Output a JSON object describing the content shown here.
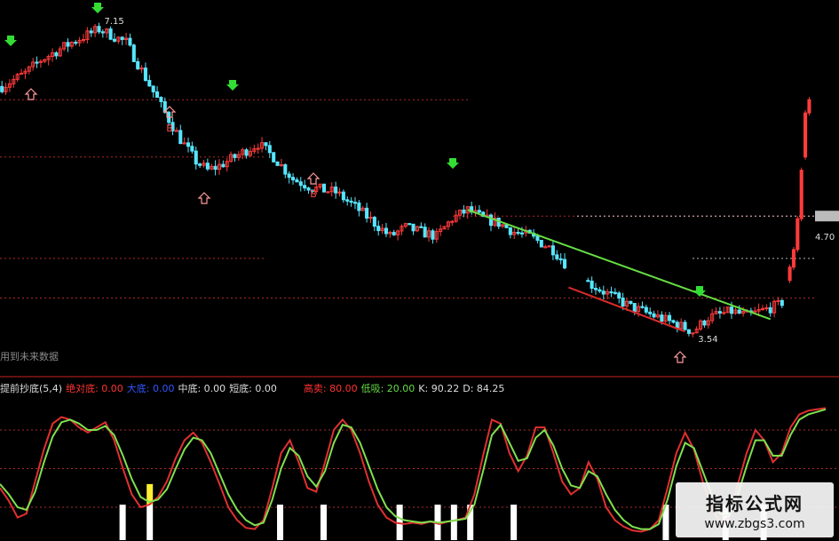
{
  "colors": {
    "background": "#000000",
    "up": "#ff3b3b",
    "down": "#56e6ff",
    "trend_green": "#66dd44",
    "trend_red": "#d92b2b",
    "dotted_level": "#cc3333",
    "arrow_green": "#33dd33",
    "fast_line": "#e03030",
    "slow_line": "#7fe04f",
    "bottom_bar": "#ffffff",
    "signal_bar": "#ffee33"
  },
  "price_labels": {
    "high": "7.15",
    "low": "3.54",
    "right_marker": "4.70"
  },
  "buy_label": "B",
  "hint_text": "用到未来数据",
  "indicator_header": [
    {
      "text": "提前抄底(5,4)",
      "color": "#dddddd"
    },
    {
      "text": "绝对底: 0.00",
      "color": "#ff3333"
    },
    {
      "text": "大底: 0.00",
      "color": "#3355ff"
    },
    {
      "text": "中底: 0.00",
      "color": "#dddddd"
    },
    {
      "text": "短底: 0.00",
      "color": "#dddddd"
    },
    {
      "text": "高卖: 80.00",
      "color": "#ff3333"
    },
    {
      "text": "低吸: 20.00",
      "color": "#66dd44"
    },
    {
      "text": "K: 90.22",
      "color": "#dddddd"
    },
    {
      "text": "D: 84.25",
      "color": "#dddddd"
    }
  ],
  "watermark": {
    "title": "指标公式网",
    "url": "www.zbgs3.com"
  },
  "chart_data": [
    {
      "type": "candlestick",
      "title": "",
      "ylim": [
        3.3,
        7.3
      ],
      "reference_levels": [
        6.25,
        5.6,
        4.93,
        4.45,
        4.0
      ],
      "trendlines": [
        {
          "name": "",
          "color": "green",
          "from": {
            "bar": 120,
            "price": 5.0
          },
          "to": {
            "bar": 198,
            "price": 3.76
          }
        },
        {
          "name": "",
          "color": "red",
          "from": {
            "bar": 146,
            "price": 4.12
          },
          "to": {
            "bar": 176,
            "price": 3.62
          }
        }
      ],
      "extremes": [
        {
          "label": "7.15",
          "bar": 25,
          "price": 7.15
        },
        {
          "label": "3.54",
          "bar": 178,
          "price": 3.54
        }
      ]
    },
    {
      "type": "line",
      "title": "提前抄底(5,4)",
      "ylim": [
        0,
        100
      ],
      "reference_levels": [
        80,
        50,
        20
      ],
      "series": [
        {
          "name": "K",
          "color": "#e03030",
          "values": [
            35,
            25,
            12,
            15,
            40,
            65,
            85,
            90,
            88,
            82,
            78,
            82,
            86,
            72,
            50,
            30,
            20,
            22,
            28,
            40,
            58,
            72,
            78,
            70,
            55,
            38,
            20,
            10,
            4,
            3,
            10,
            35,
            62,
            72,
            55,
            35,
            32,
            55,
            80,
            88,
            80,
            62,
            40,
            22,
            12,
            8,
            7,
            8,
            7,
            9,
            7,
            9,
            10,
            12,
            30,
            60,
            88,
            85,
            62,
            48,
            60,
            82,
            82,
            62,
            40,
            30,
            35,
            55,
            42,
            20,
            10,
            5,
            2,
            1,
            3,
            10,
            35,
            62,
            78,
            65,
            40,
            20,
            8,
            12,
            38,
            62,
            80,
            72,
            55,
            62,
            82,
            92,
            95,
            96,
            97
          ]
        },
        {
          "name": "D",
          "color": "#7fe04f",
          "values": [
            38,
            30,
            20,
            18,
            32,
            55,
            75,
            86,
            88,
            85,
            80,
            80,
            83,
            76,
            60,
            42,
            28,
            24,
            26,
            34,
            50,
            65,
            74,
            72,
            62,
            46,
            30,
            18,
            10,
            6,
            8,
            26,
            50,
            66,
            60,
            44,
            36,
            48,
            70,
            84,
            82,
            70,
            52,
            34,
            20,
            13,
            10,
            9,
            8,
            9,
            8,
            9,
            10,
            11,
            22,
            48,
            76,
            84,
            70,
            56,
            58,
            74,
            80,
            68,
            50,
            37,
            35,
            48,
            44,
            30,
            18,
            10,
            5,
            3,
            3,
            7,
            26,
            52,
            70,
            66,
            48,
            30,
            15,
            13,
            30,
            52,
            72,
            72,
            60,
            60,
            76,
            88,
            92,
            94,
            96
          ]
        }
      ],
      "signals": [
        {
          "kind": "bottom",
          "positions": [
            22,
            27,
            51,
            59,
            73,
            80,
            83,
            86,
            94,
            122,
            133,
            140
          ]
        },
        {
          "kind": "highlight",
          "positions": [
            27
          ]
        }
      ]
    }
  ]
}
